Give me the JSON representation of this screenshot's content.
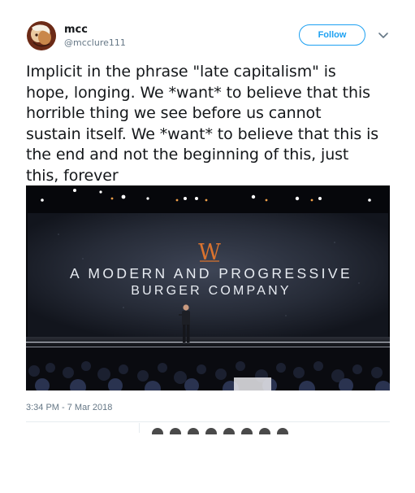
{
  "user": {
    "display_name": "mcc",
    "screen_name": "@mcclure111",
    "avatar_icon": "avatar-image"
  },
  "follow_label": "Follow",
  "tweet": {
    "lines": [
      "Implicit in the phrase \"late capitalism\" is",
      "hope, longing. We *want* to believe that this",
      "horrible thing we see before us cannot",
      "sustain itself. We *want* to believe that this is",
      "the end and not the beginning of this, just",
      "this, forever"
    ]
  },
  "media": {
    "logo_letter": "W",
    "headline_1": "A MODERN AND PROGRESSIVE",
    "headline_2": "BURGER COMPANY"
  },
  "timestamp": "3:34 PM - 7 Mar 2018",
  "colors": {
    "accent": "#1da1f2",
    "secondary_text": "#657786",
    "logo_orange": "#d9732f"
  }
}
